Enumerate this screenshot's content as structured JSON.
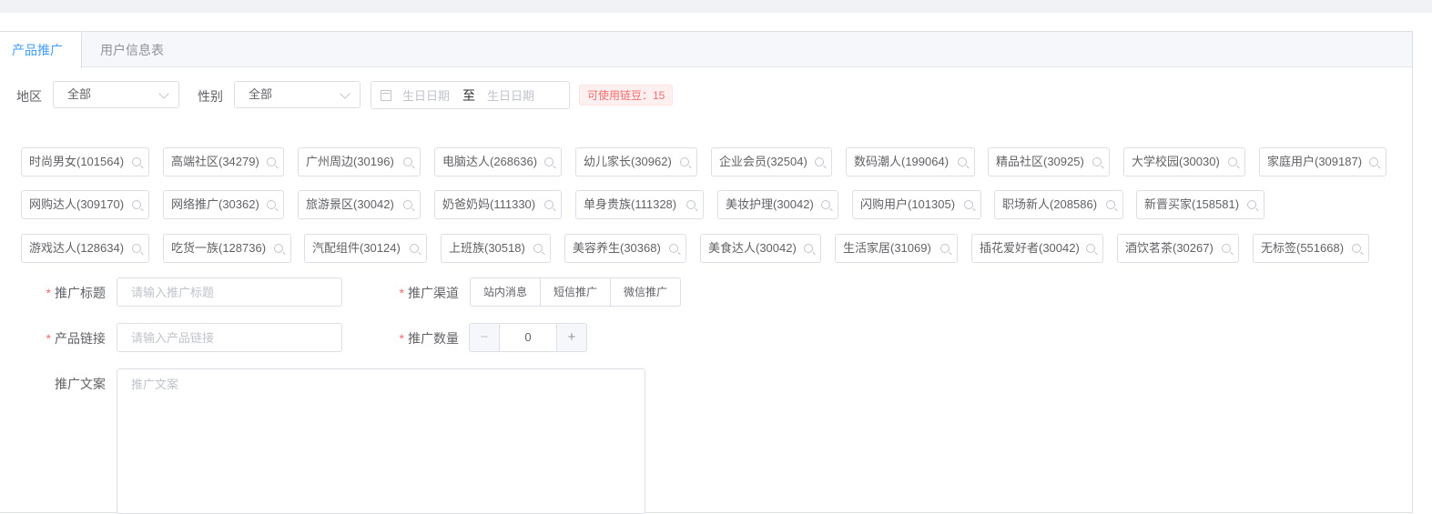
{
  "tabs": [
    {
      "label": "产品推广",
      "active": true
    },
    {
      "label": "用户信息表",
      "active": false
    }
  ],
  "filters": {
    "region_label": "地区",
    "region_value": "全部",
    "gender_label": "性别",
    "gender_value": "全部",
    "date_start_placeholder": "生日日期",
    "date_separator": "至",
    "date_end_placeholder": "生日日期",
    "beans_text": "可使用链豆：15"
  },
  "tags": [
    "时尚男女(101564)",
    "高端社区(34279)",
    "广州周边(30196)",
    "电脑达人(268636)",
    "幼儿家长(30962)",
    "企业会员(32504)",
    "数码潮人(199064)",
    "精品社区(30925)",
    "大学校园(30030)",
    "家庭用户(309187)",
    "网购达人(309170)",
    "网络推广(30362)",
    "旅游景区(30042)",
    "奶爸奶妈(111330)",
    "单身贵族(111328)",
    "美妆护理(30042)",
    "闪购用户(101305)",
    "职场新人(208586)",
    "新晋买家(158581)",
    "游戏达人(128634)",
    "吃货一族(128736)",
    "汽配组件(30124)",
    "上班族(30518)",
    "美容养生(30368)",
    "美食达人(30042)",
    "生活家居(31069)",
    "插花爱好者(30042)",
    "酒饮茗茶(30267)",
    "无标签(551668)"
  ],
  "form": {
    "title_label": "推广标题",
    "title_placeholder": "请输入推广标题",
    "channel_label": "推广渠道",
    "channels": [
      "站内消息",
      "短信推广",
      "微信推广"
    ],
    "link_label": "产品链接",
    "link_placeholder": "请输入产品链接",
    "quantity_label": "推广数量",
    "quantity_value": "0",
    "quantity_minus": "−",
    "quantity_plus": "+",
    "copy_label": "推广文案",
    "copy_placeholder": "推广文案",
    "required_mark": "*"
  }
}
